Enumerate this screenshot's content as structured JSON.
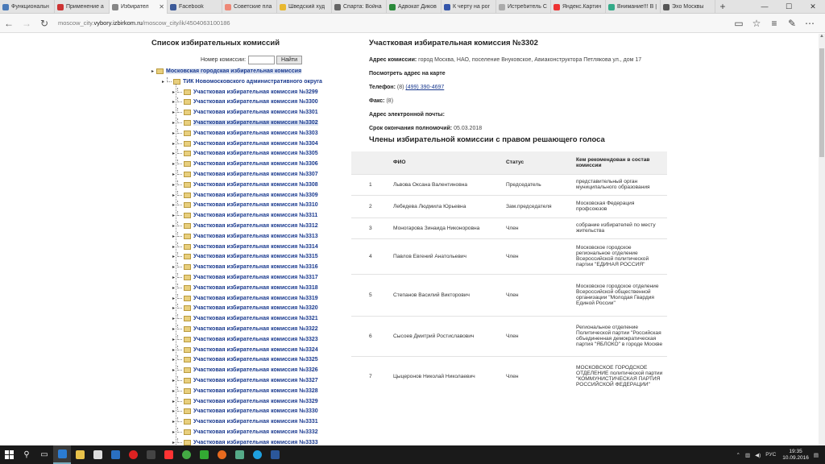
{
  "browser": {
    "tabs": [
      {
        "title": "Функциональн",
        "color": "#4a7ab8"
      },
      {
        "title": "Применение а",
        "color": "#c33"
      },
      {
        "title": "Избирател",
        "color": "#888",
        "active": true
      },
      {
        "title": "Facebook",
        "color": "#3b5998"
      },
      {
        "title": "Советские пла",
        "color": "#e87"
      },
      {
        "title": "Шведский худ",
        "color": "#e8b830"
      },
      {
        "title": "Спарта: Война",
        "color": "#666"
      },
      {
        "title": "Адвокат Диков",
        "color": "#2a8a3a"
      },
      {
        "title": "К черту на рог",
        "color": "#35a"
      },
      {
        "title": "Истребитель С",
        "color": "#aaa"
      },
      {
        "title": "Яндекс.Картин",
        "color": "#e33"
      },
      {
        "title": "Внимание!!! В |",
        "color": "#3a8"
      },
      {
        "title": "Эхо Москвы",
        "color": "#555"
      }
    ],
    "url_prefix": "moscow_city.",
    "url_domain": "vybory.izbirkom.ru",
    "url_suffix": "/moscow_city/ik/4504063100186"
  },
  "left": {
    "title": "Список избирательных комиссий",
    "search_label": "Номер комиссии:",
    "search_value": "",
    "search_button": "Найти",
    "root": "Московская городская избирательная комиссия",
    "tik": "ТИК Новомосковского административного округа",
    "items": [
      "Участковая избирательная комиссия №3299",
      "Участковая избирательная комиссия №3300",
      "Участковая избирательная комиссия №3301",
      "Участковая избирательная комиссия №3302",
      "Участковая избирательная комиссия №3303",
      "Участковая избирательная комиссия №3304",
      "Участковая избирательная комиссия №3305",
      "Участковая избирательная комиссия №3306",
      "Участковая избирательная комиссия №3307",
      "Участковая избирательная комиссия №3308",
      "Участковая избирательная комиссия №3309",
      "Участковая избирательная комиссия №3310",
      "Участковая избирательная комиссия №3311",
      "Участковая избирательная комиссия №3312",
      "Участковая избирательная комиссия №3313",
      "Участковая избирательная комиссия №3314",
      "Участковая избирательная комиссия №3315",
      "Участковая избирательная комиссия №3316",
      "Участковая избирательная комиссия №3317",
      "Участковая избирательная комиссия №3318",
      "Участковая избирательная комиссия №3319",
      "Участковая избирательная комиссия №3320",
      "Участковая избирательная комиссия №3321",
      "Участковая избирательная комиссия №3322",
      "Участковая избирательная комиссия №3323",
      "Участковая избирательная комиссия №3324",
      "Участковая избирательная комиссия №3325",
      "Участковая избирательная комиссия №3326",
      "Участковая избирательная комиссия №3327",
      "Участковая избирательная комиссия №3328",
      "Участковая избирательная комиссия №3329",
      "Участковая избирательная комиссия №3330",
      "Участковая избирательная комиссия №3331",
      "Участковая избирательная комиссия №3332",
      "Участковая избирательная комиссия №3333"
    ],
    "selected_index": 3
  },
  "uik": {
    "title": "Участковая избирательная комиссия №3302",
    "address_label": "Адрес комиссии:",
    "address_value": "город Москва, НАО, поселение Внуковское, Авиаконструктора Петлякова ул., дом 17",
    "map_link": "Посмотреть адрес на карте",
    "phone_label": "Телефон:",
    "phone_code": "(8)",
    "phone_number": "(499) 390-4697",
    "fax_label": "Факс:",
    "fax_value": "(8)",
    "email_label": "Адрес электронной почты:",
    "term_label": "Срок окончания полномочий:",
    "term_value": "05.03.2018"
  },
  "members": {
    "title": "Члены избирательной комиссии с правом решающего голоса",
    "headers": [
      "",
      "ФИО",
      "Статус",
      "Кем рекомендован в состав комиссии"
    ],
    "rows": [
      [
        "1",
        "Львова Оксана Валентиновна",
        "Председатель",
        "представительный орган муниципального образования"
      ],
      [
        "2",
        "Лебедева Людмила Юрьевна",
        "Зам.председателя",
        "Московская Федерация профсоюзов"
      ],
      [
        "3",
        "Моногарова Зинаида Никоноровна",
        "Член",
        "собрание избирателей по месту жительства"
      ],
      [
        "4",
        "Павлов Евгений Анатольевич",
        "Член",
        "Московское городское региональное отделение Всероссийской политической партии \"ЕДИНАЯ РОССИЯ\""
      ],
      [
        "5",
        "Степанов Василий Викторович",
        "Член",
        "Московское городское отделение Всероссийской общественной организации \"Молодая Гвардия Единой России\""
      ],
      [
        "6",
        "Сысоев Дмитрий Ростиславович",
        "Член",
        "Региональное отделение Политической партии \"Российская объединенная демократическая партия \"ЯБЛОКО\" в городе Москве"
      ],
      [
        "7",
        "Цыцеронов Николай Николаевич",
        "Член",
        "МОСКОВСКОЕ ГОРОДСКОЕ ОТДЕЛЕНИЕ политической партии \"КОММУНИСТИЧЕСКАЯ ПАРТИЯ РОССИЙСКОЙ ФЕДЕРАЦИИ\""
      ]
    ]
  },
  "taskbar": {
    "lang": "РУС",
    "time": "19:35",
    "date": "10.09.2016"
  }
}
